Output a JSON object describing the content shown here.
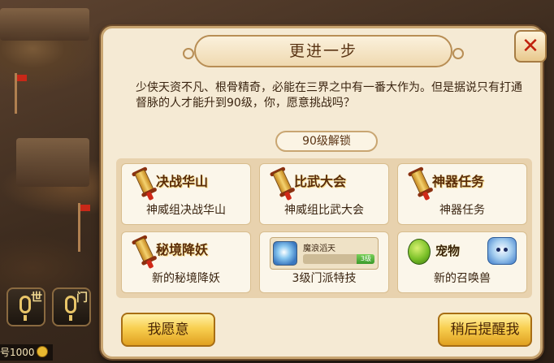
{
  "hud": {
    "voice_world_label": "世",
    "voice_sect_label": "门",
    "gold_text": "号1000"
  },
  "dialog": {
    "title": "更进一步",
    "close_label": "✕",
    "message": "少侠天资不凡、根骨精奇，必能在三界之中有一番大作为。但是据说只有打通督脉的人才能升到90级，你，愿意挑战吗？",
    "unlock_header": "90级解锁",
    "features": [
      {
        "icon_text": "决战华山",
        "caption": "神威组决战华山",
        "icon": "scroll-icon"
      },
      {
        "icon_text": "比武大会",
        "caption": "神威组比武大会",
        "icon": "scroll-icon"
      },
      {
        "icon_text": "神器任务",
        "caption": "神器任务",
        "icon": "scroll-icon"
      },
      {
        "icon_text": "秘境降妖",
        "caption": "新的秘境降妖",
        "icon": "scroll-icon"
      },
      {
        "skill_name": "魔浪滔天",
        "skill_level": "3级",
        "skill_progress": 0.25,
        "caption": "3级门派特技",
        "icon": "skill-icon"
      },
      {
        "icon_text": "宠物",
        "caption": "新的召唤兽",
        "icon": "pet-egg-icon"
      }
    ],
    "accept_label": "我愿意",
    "later_label": "稍后提醒我"
  },
  "colors": {
    "panel_bg": "#f5ead4",
    "panel_border": "#c9a672",
    "button_gold": "#f8cf50",
    "close_red": "#c0200c"
  }
}
